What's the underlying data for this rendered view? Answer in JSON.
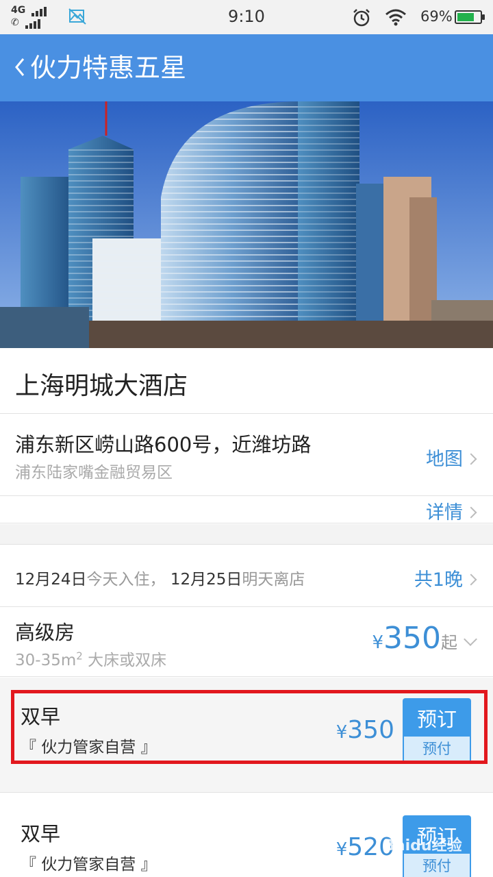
{
  "status_bar": {
    "network": "4G",
    "time": "9:10",
    "battery": "69%",
    "icons": [
      "signal-icon",
      "image-icon",
      "alarm-icon",
      "wifi-icon",
      "battery-icon"
    ]
  },
  "header": {
    "back_icon": "chevron-left-icon",
    "title": "伙力特惠五星"
  },
  "hotel": {
    "name": "上海明城大酒店",
    "address": "浦东新区崂山路600号，近潍坊路",
    "area": "浦东陆家嘴金融贸易区",
    "map_label": "地图",
    "details_label": "详情"
  },
  "stay": {
    "checkin_date": "12月24日",
    "checkin_text": "今天入住，",
    "checkout_date": "12月25日",
    "checkout_text": "明天离店",
    "nights": "共1晚"
  },
  "room": {
    "name": "高级房",
    "size": "30-35m",
    "size_sup": "2",
    "bed": " 大床或双床",
    "currency": "¥",
    "price": "350",
    "price_suffix": "起"
  },
  "offers": [
    {
      "plan": "双早",
      "vendor": "『 伙力管家自营 』",
      "currency": "¥",
      "price": "350",
      "book_label": "预订",
      "pay_label": "预付"
    },
    {
      "plan": "双早",
      "vendor": "『 伙力管家自营 』",
      "currency": "¥",
      "price": "520",
      "book_label": "预订",
      "pay_label": "预付"
    }
  ],
  "watermark": "Baidu经验",
  "colors": {
    "header_bg": "#4a90e2",
    "link": "#3d8fd6",
    "button": "#3d9be9",
    "highlight_border": "#e2181e"
  }
}
